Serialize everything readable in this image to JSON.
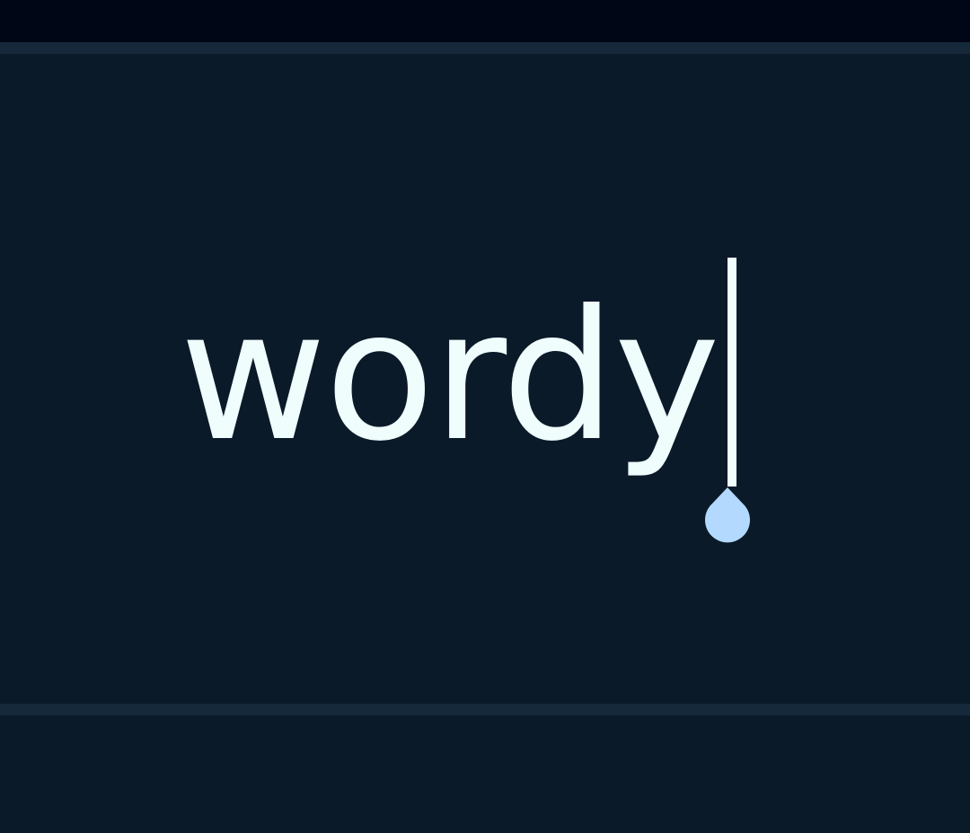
{
  "editor": {
    "value": "wordy",
    "text_color": "#effdfd",
    "background": "#0b1a29",
    "caret_color": "#effdfd",
    "handle_color": "#b3d9ff",
    "handle_icon": "text-cursor-handle-icon"
  },
  "chrome": {
    "status_bar_color": "#010616",
    "divider_color": "#15293b"
  }
}
